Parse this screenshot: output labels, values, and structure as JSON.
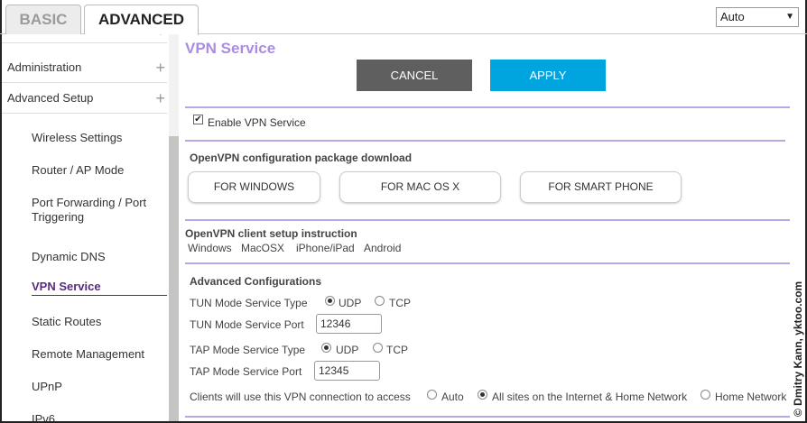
{
  "tabs": {
    "basic": "BASIC",
    "advanced": "ADVANCED"
  },
  "language": {
    "selected": "Auto"
  },
  "sidebar": {
    "sections": [
      {
        "label": "Administration"
      },
      {
        "label": "Advanced Setup"
      }
    ],
    "items": [
      {
        "label": "Wireless Settings"
      },
      {
        "label": "Router / AP Mode"
      },
      {
        "label": "Port Forwarding / Port Triggering"
      },
      {
        "label": "Dynamic DNS"
      },
      {
        "label": "VPN Service"
      },
      {
        "label": "Static Routes"
      },
      {
        "label": "Remote Management"
      },
      {
        "label": "UPnP"
      },
      {
        "label": "IPv6"
      }
    ],
    "active": "VPN Service"
  },
  "page": {
    "title": "VPN Service"
  },
  "actions": {
    "cancel": "CANCEL",
    "apply": "APPLY"
  },
  "enable": {
    "label": "Enable VPN Service",
    "checked": true
  },
  "download": {
    "title": "OpenVPN configuration package download",
    "buttons": [
      "FOR WINDOWS",
      "FOR MAC OS X",
      "FOR SMART PHONE"
    ]
  },
  "instructions": {
    "title": "OpenVPN client setup instruction",
    "links": [
      "Windows",
      "MacOSX",
      "iPhone/iPad",
      "Android"
    ]
  },
  "advanced": {
    "title": "Advanced Configurations",
    "tun_type_label": "TUN Mode Service Type",
    "tun_port_label": "TUN Mode Service Port",
    "tun_port": "12346",
    "tun_type": "UDP",
    "tap_type_label": "TAP Mode Service Type",
    "tap_port_label": "TAP Mode Service Port",
    "tap_port": "12345",
    "tap_type": "UDP",
    "udp": "UDP",
    "tcp": "TCP",
    "access_label": "Clients will use this VPN connection to access",
    "access_options": [
      "Auto",
      "All sites on the Internet & Home Network",
      "Home Network"
    ],
    "access_selected": "All sites on the Internet & Home Network"
  },
  "watermark": "© Dmitry Kann, yktoo.com",
  "colors": {
    "accent": "#a98de3",
    "apply": "#00a5e0",
    "cancel": "#5f5f5f",
    "active_nav": "#5a2a82"
  }
}
